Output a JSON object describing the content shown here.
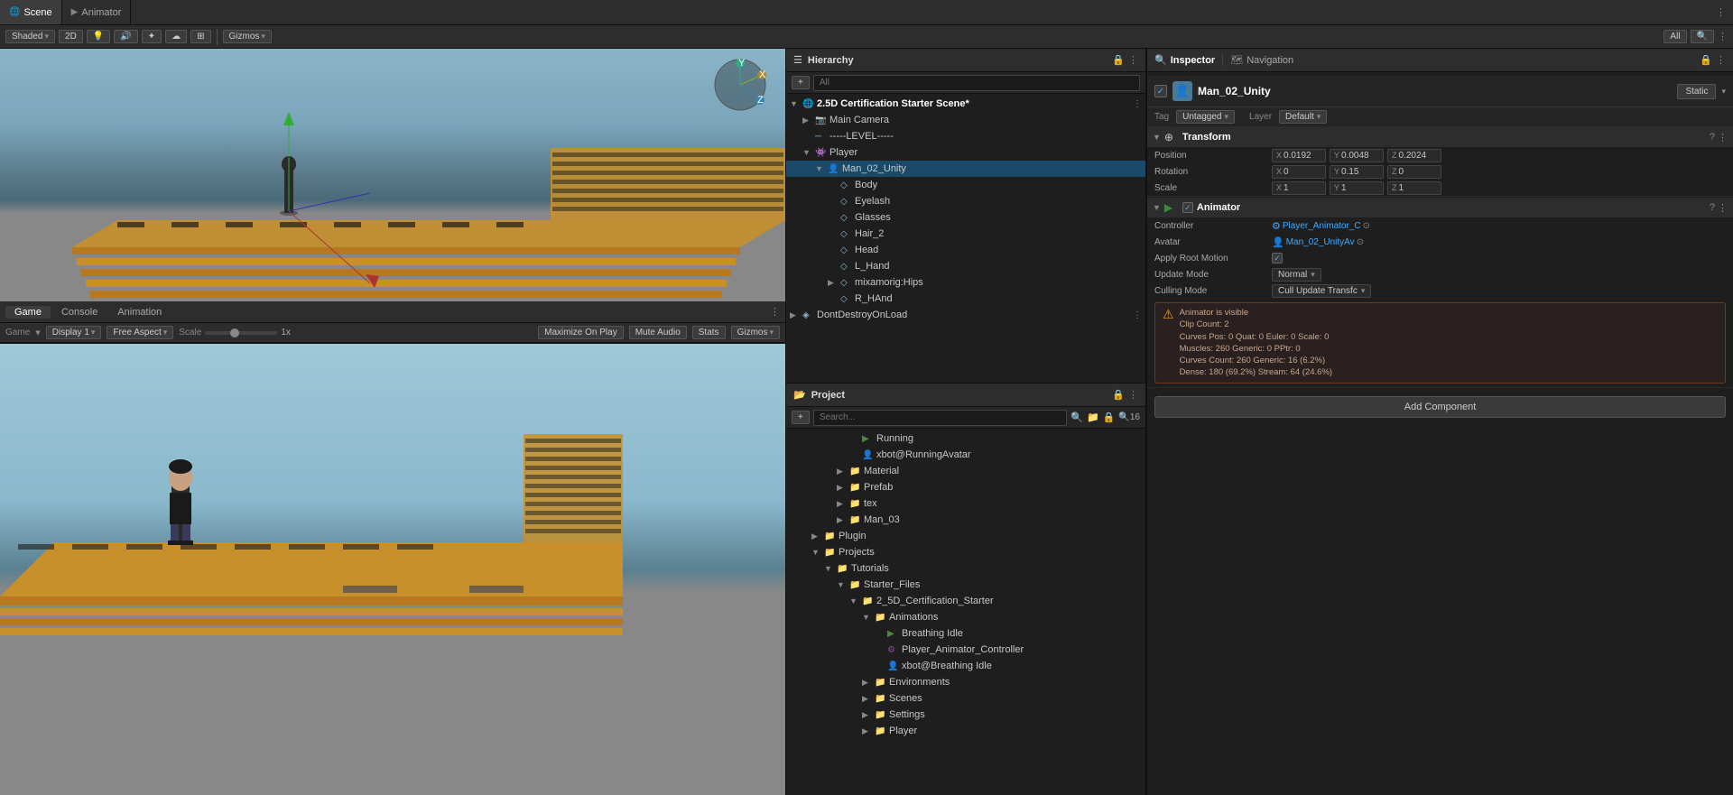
{
  "window": {
    "scene_tab": "Scene",
    "animator_tab": "Animator",
    "hierarchy_tab": "Hierarchy",
    "inspector_tab": "Inspector",
    "navigation_tab": "Navigation",
    "game_tab": "Game",
    "console_tab": "Console",
    "animation_tab": "Animation",
    "project_tab": "Project"
  },
  "toolbar": {
    "shaded_label": "Shaded",
    "twod_label": "2D",
    "gizmos_label": "Gizmos",
    "all_label": "All"
  },
  "game_toolbar": {
    "display_label": "Display 1",
    "aspect_label": "Free Aspect",
    "scale_label": "Scale",
    "scale_value": "1x",
    "maximize_label": "Maximize On Play",
    "mute_label": "Mute Audio",
    "stats_label": "Stats",
    "gizmos_label": "Gizmos"
  },
  "hierarchy": {
    "title": "Hierarchy",
    "search_placeholder": "All",
    "scene_name": "2.5D Certification Starter Scene*",
    "items": [
      {
        "label": "Main Camera",
        "depth": 2,
        "icon": "📷",
        "expanded": false
      },
      {
        "label": "-----LEVEL-----",
        "depth": 2,
        "icon": "─",
        "expanded": false
      },
      {
        "label": "Player",
        "depth": 2,
        "icon": "▶",
        "expanded": true
      },
      {
        "label": "Man_02_Unity",
        "depth": 3,
        "icon": "👤",
        "expanded": true,
        "selected": true
      },
      {
        "label": "Body",
        "depth": 4,
        "icon": "◇",
        "expanded": false
      },
      {
        "label": "Eyelash",
        "depth": 4,
        "icon": "◇",
        "expanded": false
      },
      {
        "label": "Glasses",
        "depth": 4,
        "icon": "◇",
        "expanded": false
      },
      {
        "label": "Hair_2",
        "depth": 4,
        "icon": "◇",
        "expanded": false
      },
      {
        "label": "Head",
        "depth": 4,
        "icon": "◇",
        "expanded": false
      },
      {
        "label": "L_Hand",
        "depth": 4,
        "icon": "◇",
        "expanded": false
      },
      {
        "label": "mixamorig:Hips",
        "depth": 4,
        "icon": "◇",
        "expanded": false
      },
      {
        "label": "R_HAnd",
        "depth": 4,
        "icon": "◇",
        "expanded": false
      },
      {
        "label": "DontDestroyOnLoad",
        "depth": 1,
        "icon": "◈",
        "expanded": false
      }
    ]
  },
  "inspector": {
    "title": "Inspector",
    "object_name": "Man_02_Unity",
    "static_label": "Static",
    "tag_label": "Tag",
    "tag_value": "Untagged",
    "layer_label": "Layer",
    "layer_value": "Default",
    "transform": {
      "title": "Transform",
      "position_label": "Position",
      "pos_x": "0.0192",
      "pos_y": "0.0048",
      "pos_z": "0.2024",
      "rotation_label": "Rotation",
      "rot_x": "0",
      "rot_y": "0.15",
      "rot_z": "0",
      "scale_label": "Scale",
      "scale_x": "1",
      "scale_y": "1",
      "scale_z": "1"
    },
    "animator": {
      "title": "Animator",
      "controller_label": "Controller",
      "controller_value": "Player_Animator_C",
      "avatar_label": "Avatar",
      "avatar_value": "Man_02_UnityAv",
      "apply_root_motion_label": "Apply Root Motion",
      "apply_root_motion_value": true,
      "update_mode_label": "Update Mode",
      "update_mode_value": "Normal",
      "culling_mode_label": "Culling Mode",
      "culling_mode_value": "Cull Update Transfc",
      "info": {
        "line1": "Animator is visible",
        "line2": "Clip Count: 2",
        "line3": "Curves Pos: 0 Quat: 0 Euler: 0 Scale: 0",
        "line4": "Muscles: 260 Generic: 0 PPtr: 0",
        "line5": "Curves Count: 260 Generic: 16 (6.2%)",
        "line6": "Dense: 180 (69.2%) Stream: 64 (24.6%)"
      }
    },
    "add_component": "Add Component"
  },
  "project": {
    "title": "Project",
    "items": [
      {
        "label": "Running",
        "depth": 5,
        "icon": "▶",
        "type": "anim"
      },
      {
        "label": "xbot@RunningAvatar",
        "depth": 5,
        "icon": "👤",
        "type": "avatar"
      },
      {
        "label": "Material",
        "depth": 4,
        "icon": "📁",
        "type": "folder"
      },
      {
        "label": "Prefab",
        "depth": 4,
        "icon": "📁",
        "type": "folder"
      },
      {
        "label": "tex",
        "depth": 4,
        "icon": "📁",
        "type": "folder"
      },
      {
        "label": "Man_03",
        "depth": 4,
        "icon": "📁",
        "type": "folder"
      },
      {
        "label": "Plugin",
        "depth": 3,
        "icon": "📁",
        "type": "folder"
      },
      {
        "label": "Projects",
        "depth": 3,
        "icon": "📁",
        "type": "folder",
        "expanded": true
      },
      {
        "label": "Tutorials",
        "depth": 4,
        "icon": "📁",
        "type": "folder",
        "expanded": true
      },
      {
        "label": "Starter_Files",
        "depth": 5,
        "icon": "📁",
        "type": "folder",
        "expanded": true
      },
      {
        "label": "2_5D_Certification_Starter",
        "depth": 6,
        "icon": "📁",
        "type": "folder",
        "expanded": true
      },
      {
        "label": "Animations",
        "depth": 7,
        "icon": "📁",
        "type": "folder",
        "expanded": true
      },
      {
        "label": "Breathing Idle",
        "depth": 8,
        "icon": "▶",
        "type": "anim"
      },
      {
        "label": "Player_Animator_Controller",
        "depth": 8,
        "icon": "⚙",
        "type": "controller"
      },
      {
        "label": "xbot@Breathing Idle",
        "depth": 8,
        "icon": "👤",
        "type": "avatar"
      },
      {
        "label": "Environments",
        "depth": 7,
        "icon": "📁",
        "type": "folder"
      },
      {
        "label": "Scenes",
        "depth": 7,
        "icon": "📁",
        "type": "folder"
      },
      {
        "label": "Settings",
        "depth": 7,
        "icon": "📁",
        "type": "folder"
      },
      {
        "label": "Player",
        "depth": 7,
        "icon": "📁",
        "type": "folder"
      }
    ]
  }
}
